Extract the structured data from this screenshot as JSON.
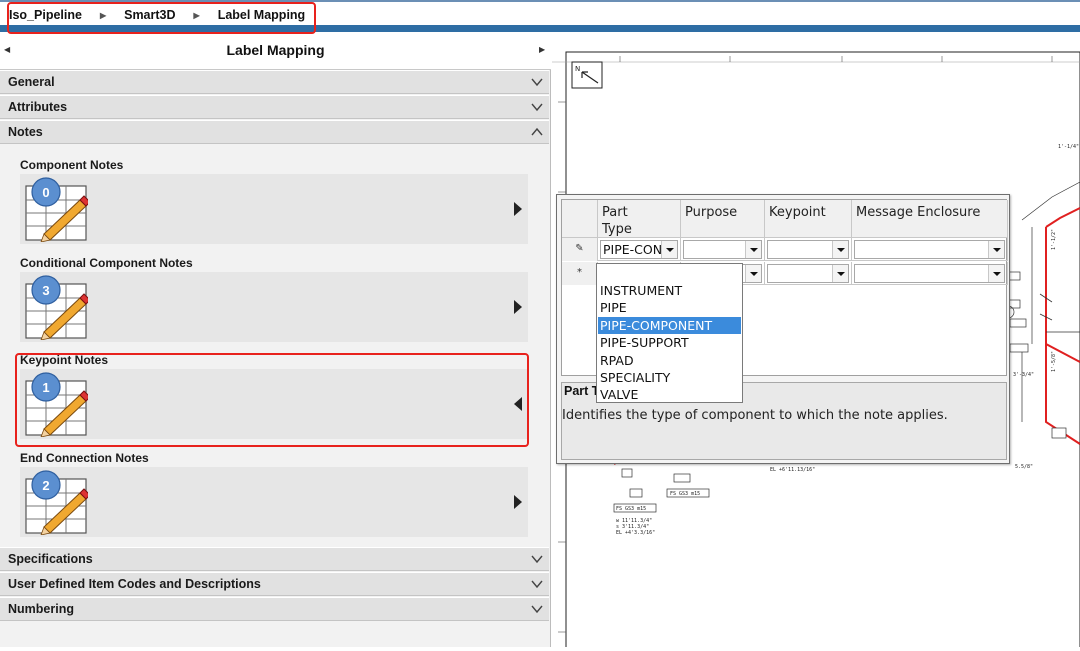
{
  "breadcrumb": {
    "items": [
      "Iso_Pipeline",
      "Smart3D",
      "Label Mapping"
    ]
  },
  "pane": {
    "title": "Label Mapping"
  },
  "sections": {
    "general": "General",
    "attributes": "Attributes",
    "notes": "Notes",
    "specifications": "Specifications",
    "user_defined": "User Defined Item Codes and Descriptions",
    "numbering": "Numbering"
  },
  "notes": [
    {
      "title": "Component Notes",
      "count": "0"
    },
    {
      "title": "Conditional Component Notes",
      "count": "3"
    },
    {
      "title": "Keypoint Notes",
      "count": "1"
    },
    {
      "title": "End Connection Notes",
      "count": "2"
    }
  ],
  "grid": {
    "columns": [
      "Part Type",
      "Purpose",
      "Keypoint",
      "Message Enclosure"
    ],
    "row1": {
      "marker": "✎",
      "part_type": "PIPE-CON"
    },
    "row2": {
      "marker": "*"
    }
  },
  "dropdown": {
    "options": [
      "INSTRUMENT",
      "PIPE",
      "PIPE-COMPONENT",
      "PIPE-SUPPORT",
      "RPAD",
      "SPECIALITY",
      "VALVE"
    ],
    "selected": "PIPE-COMPONENT"
  },
  "description": {
    "title": "Part T",
    "text": "Identifies the type of component to which the note applies."
  },
  "drawing": {
    "north": "N",
    "labels": [
      "1'-1/4\"",
      "1'-1/2\"",
      "1'-5/8\"",
      "3'-3/4\"",
      "5.5/8\"",
      "EL +6'11.13/16\"",
      "FS GS3 m15",
      "FS GS3 m15",
      "w 11'11.3/4\"",
      "s 3'11.3/4\"",
      "EL +4'3.3/16\""
    ]
  },
  "colors": {
    "accent": "#2e6da4",
    "highlight": "#e8221d",
    "selection": "#3b8bdc",
    "pipe": "#e02020"
  }
}
